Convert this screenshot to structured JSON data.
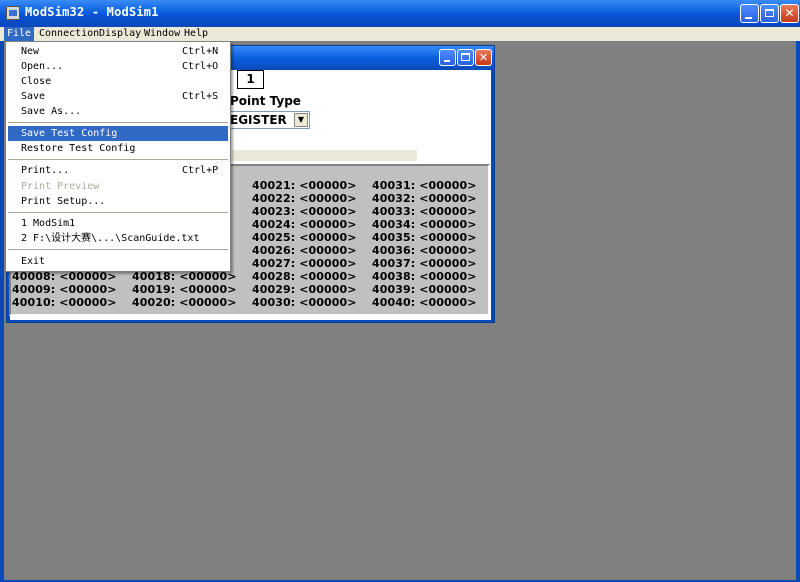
{
  "app": {
    "title": "ModSim32 - ModSim1"
  },
  "menubar": {
    "items": [
      "File",
      "Connection",
      "Display",
      "Window",
      "Help"
    ]
  },
  "file_menu": {
    "items": [
      {
        "label": "New",
        "shortcut": "Ctrl+N"
      },
      {
        "label": "Open...",
        "shortcut": "Ctrl+O"
      },
      {
        "label": "Close",
        "shortcut": ""
      },
      {
        "label": "Save",
        "shortcut": "Ctrl+S"
      },
      {
        "label": "Save As...",
        "shortcut": ""
      },
      {
        "label": "Save Test Config",
        "shortcut": "",
        "highlighted": true
      },
      {
        "label": "Restore Test Config",
        "shortcut": ""
      },
      {
        "label": "Print...",
        "shortcut": "Ctrl+P"
      },
      {
        "label": "Print Preview",
        "shortcut": "",
        "disabled": true
      },
      {
        "label": "Print Setup...",
        "shortcut": ""
      },
      {
        "label": "1 ModSim1",
        "shortcut": ""
      },
      {
        "label": "2 F:\\设计大赛\\...\\ScanGuide.txt",
        "shortcut": ""
      },
      {
        "label": "Exit",
        "shortcut": ""
      }
    ]
  },
  "child": {
    "length_value": "1",
    "point_type_label": "Point Type",
    "point_type_value": "EGISTER"
  },
  "registers": {
    "col1": [
      "40008: <00000>",
      "40009: <00000>",
      "40010: <00000>"
    ],
    "col2": [
      "40018: <00000>",
      "40019: <00000>",
      "40020: <00000>"
    ],
    "col3": [
      "40021: <00000>",
      "40022: <00000>",
      "40023: <00000>",
      "40024: <00000>",
      "40025: <00000>",
      "40026: <00000>",
      "40027: <00000>",
      "40028: <00000>",
      "40029: <00000>",
      "40030: <00000>"
    ],
    "col4": [
      "40031: <00000>",
      "40032: <00000>",
      "40033: <00000>",
      "40034: <00000>",
      "40035: <00000>",
      "40036: <00000>",
      "40037: <00000>",
      "40038: <00000>",
      "40039: <00000>",
      "40040: <00000>"
    ]
  },
  "colors": {
    "title_blue": "#0a5fe0",
    "menu_highlight": "#316ac5",
    "workspace": "#808080",
    "panel": "#c0c0c0"
  }
}
